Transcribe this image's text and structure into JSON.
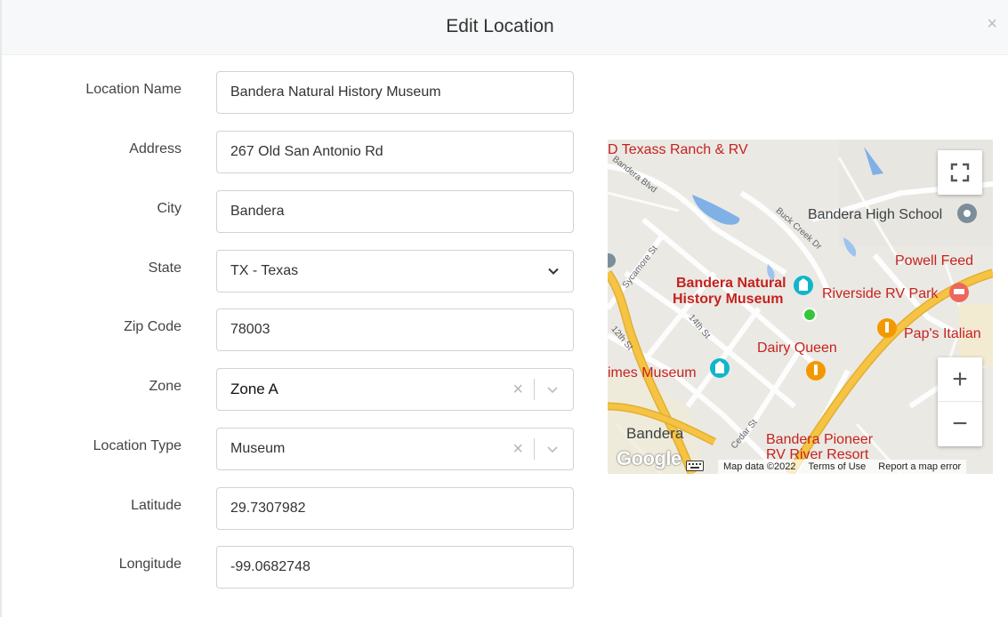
{
  "modal": {
    "title": "Edit Location",
    "close_glyph": "×"
  },
  "form": {
    "location_name": {
      "label": "Location Name",
      "value": "Bandera Natural History Museum"
    },
    "address": {
      "label": "Address",
      "value": "267 Old San Antonio Rd"
    },
    "city": {
      "label": "City",
      "value": "Bandera"
    },
    "state": {
      "label": "State",
      "value": "TX - Texas"
    },
    "zip": {
      "label": "Zip Code",
      "value": "78003"
    },
    "zone": {
      "label": "Zone",
      "value": "Zone A"
    },
    "location_type": {
      "label": "Location Type",
      "value": "Museum"
    },
    "latitude": {
      "label": "Latitude",
      "value": "29.7307982"
    },
    "longitude": {
      "label": "Longitude",
      "value": "-99.0682748"
    },
    "clear_glyph": "×"
  },
  "map": {
    "places": {
      "texas_ranch": "D Texass Ranch & RV",
      "bandera_high_school": "Bandera High School",
      "powell_feed": "Powell Feed",
      "museum_line1": "Bandera Natural",
      "museum_line2": "History Museum",
      "riverside_rv": "Riverside RV Park",
      "paps_italian": "Pap's Italian",
      "dairy_queen": "Dairy Queen",
      "times_museum": "imes Museum",
      "bandera": "Bandera",
      "pioneer_line1": "Bandera Pioneer",
      "pioneer_line2": "RV River Resort"
    },
    "streets": {
      "bandera_blvd": "Bandera Blvd",
      "buck_creek": "Buck Creek Dr",
      "sycamore": "Sycamore St",
      "fourteenth": "14th St",
      "twelfth": "12th St",
      "cedar": "Cedar St"
    },
    "zoom_in": "+",
    "zoom_out": "−",
    "google_logo": "Google",
    "footer": {
      "map_data": "Map data ©2022",
      "terms": "Terms of Use",
      "report": "Report a map error"
    },
    "colors": {
      "highway": "#f6c342",
      "water": "#7fb0e6",
      "poi_red": "#c5221f",
      "pin_green": "#34c73a"
    }
  }
}
